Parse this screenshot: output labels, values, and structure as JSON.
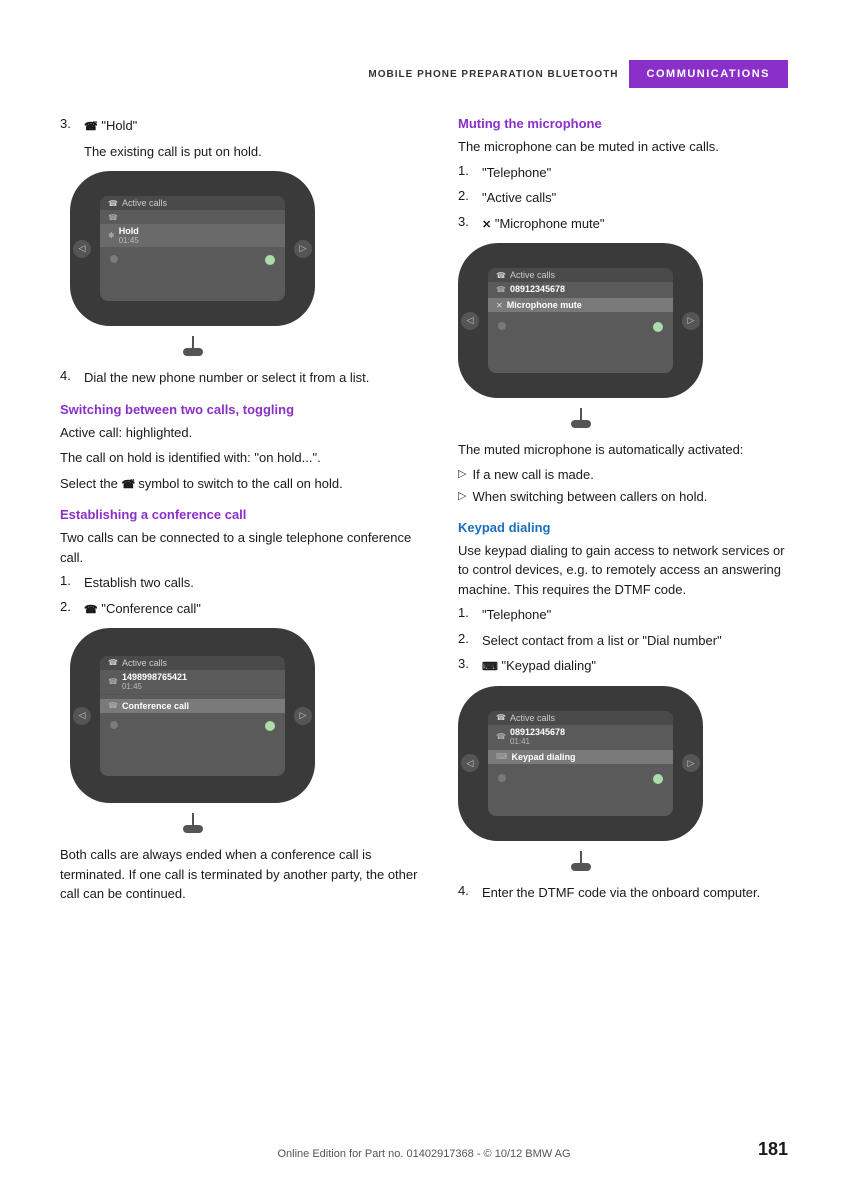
{
  "header": {
    "left_label": "MOBILE PHONE PREPARATION BLUETOOTH",
    "right_label": "COMMUNICATIONS"
  },
  "left_col": {
    "step3_num": "3.",
    "step3_icon": "☎",
    "step3_label": "\"Hold\"",
    "step3_desc": "The existing call is put on hold.",
    "screen1": {
      "title": "Active calls",
      "row1_icon": "☎",
      "row1_text": "",
      "row2_icon": "✱",
      "row2_label": "Hold",
      "row2_sub": "01:45",
      "row3_icon": "☎"
    },
    "step4_num": "4.",
    "step4_text": "Dial the new phone number or select it from a list.",
    "switching_heading": "Switching between two calls, toggling",
    "switching_p1": "Active call: highlighted.",
    "switching_p2": "The call on hold is identified with: \"on hold...\".",
    "switching_p3": "Select the",
    "switching_icon": "☎",
    "switching_p3b": "symbol to switch to the call on hold.",
    "conf_heading": "Establishing a conference call",
    "conf_p1": "Two calls can be connected to a single telephone conference call.",
    "conf_step1_num": "1.",
    "conf_step1": "Establish two calls.",
    "conf_step2_num": "2.",
    "conf_step2_icon": "☎",
    "conf_step2_label": "\"Conference call\"",
    "screen2": {
      "title": "Active calls",
      "row1_icon": "☎",
      "row1_num": "1498998765421",
      "row1_time": "01:45",
      "row2_icon": "☎",
      "row2_label": "Conference call"
    },
    "conf_note": "Both calls are always ended when a conference call is terminated. If one call is terminated by another party, the other call can be continued."
  },
  "right_col": {
    "muting_heading": "Muting the microphone",
    "muting_desc": "The microphone can be muted in active calls.",
    "muting_step1_num": "1.",
    "muting_step1": "\"Telephone\"",
    "muting_step2_num": "2.",
    "muting_step2": "\"Active calls\"",
    "muting_step3_num": "3.",
    "muting_step3_icon": "✕",
    "muting_step3_label": "\"Microphone mute\"",
    "screen3": {
      "title": "Active calls",
      "row1_icon": "☎",
      "row1_num": "08912345678",
      "row2_icon": "✕",
      "row2_label": "Microphone mute"
    },
    "muting_note1": "The muted microphone is automatically activated:",
    "muting_bullet1": "If a new call is made.",
    "muting_bullet2": "When switching between callers on hold.",
    "keypad_heading": "Keypad dialing",
    "keypad_desc": "Use keypad dialing to gain access to network services or to control devices, e.g. to remotely access an answering machine. This requires the DTMF code.",
    "keypad_step1_num": "1.",
    "keypad_step1": "\"Telephone\"",
    "keypad_step2_num": "2.",
    "keypad_step2": "Select contact from a list or \"Dial number\"",
    "keypad_step3_num": "3.",
    "keypad_step3_icon": "⌨",
    "keypad_step3_label": "\"Keypad dialing\"",
    "screen4": {
      "title": "Active calls",
      "row1_icon": "☎",
      "row1_num": "08912345678",
      "row1_time": "01:41",
      "row2_icon": "⌨",
      "row2_label": "Keypad dialing"
    },
    "keypad_step4_num": "4.",
    "keypad_step4": "Enter the DTMF code via the onboard computer."
  },
  "footer": {
    "text": "Online Edition for Part no. 01402917368 - © 10/12 BMW AG"
  },
  "page_number": "181"
}
